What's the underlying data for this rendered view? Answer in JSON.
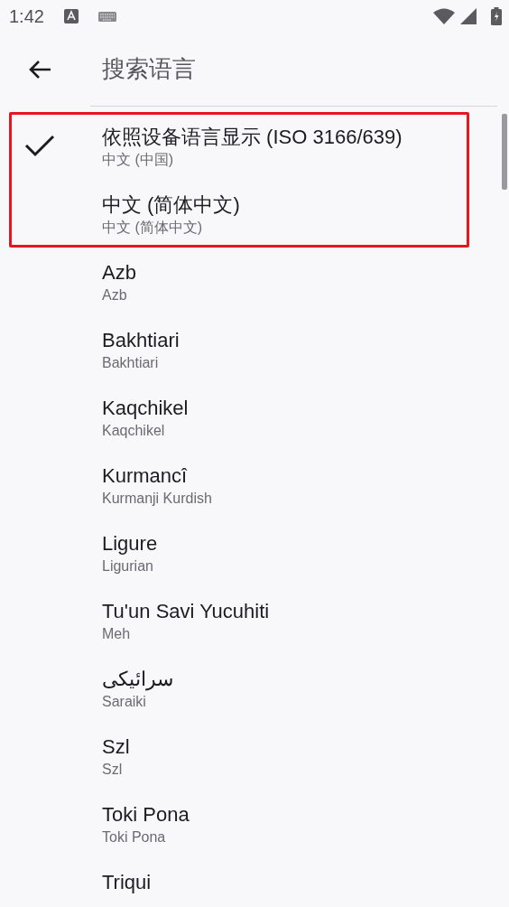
{
  "status_bar": {
    "time": "1:42"
  },
  "app_bar": {
    "search": {
      "placeholder": "搜索语言"
    }
  },
  "highlight": {
    "frame": true,
    "items": [
      {
        "title": "依照设备语言显示 (ISO 3166/639)",
        "subtitle": "中文 (中国)",
        "selected": true
      },
      {
        "title": "中文 (简体中文)",
        "subtitle": "中文 (简体中文)",
        "selected": false
      }
    ]
  },
  "items": [
    {
      "title": "Azb",
      "subtitle": "Azb",
      "selected": false
    },
    {
      "title": "Bakhtiari",
      "subtitle": "Bakhtiari",
      "selected": false
    },
    {
      "title": "Kaqchikel",
      "subtitle": "Kaqchikel",
      "selected": false
    },
    {
      "title": "Kurmancî",
      "subtitle": "Kurmanji Kurdish",
      "selected": false
    },
    {
      "title": "Ligure",
      "subtitle": "Ligurian",
      "selected": false
    },
    {
      "title": "Tu'un Savi Yucuhiti",
      "subtitle": "Meh",
      "selected": false
    },
    {
      "title": "سرائیکی",
      "subtitle": "Saraiki",
      "selected": false
    },
    {
      "title": "Szl",
      "subtitle": "Szl",
      "selected": false
    },
    {
      "title": "Toki Pona",
      "subtitle": "Toki Pona",
      "selected": false
    },
    {
      "title": "Triqui",
      "selected": false
    }
  ]
}
